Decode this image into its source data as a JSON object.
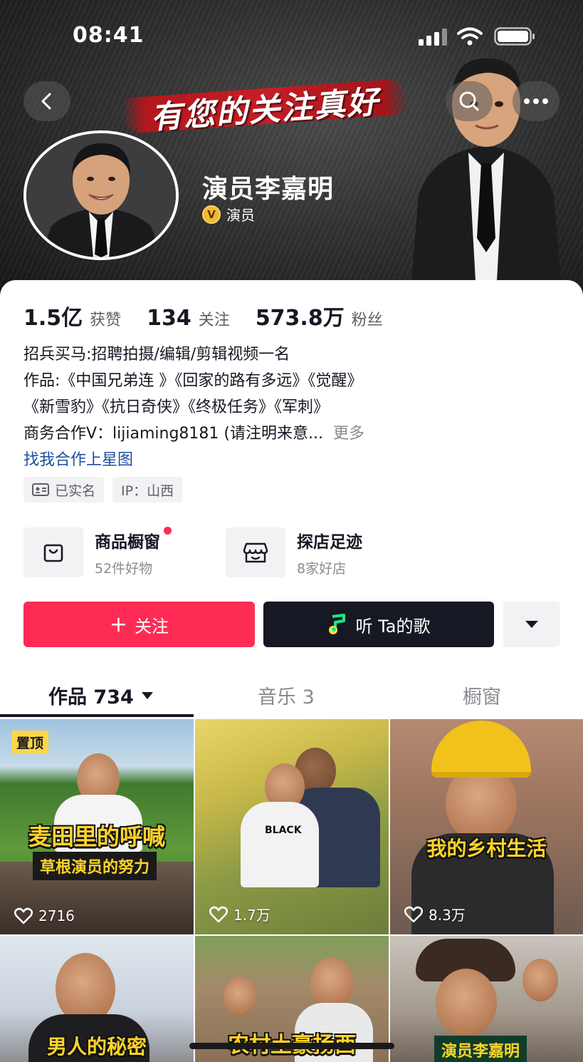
{
  "status_bar": {
    "time": "08:41"
  },
  "header": {
    "banner_text": "有您的关注真好",
    "username": "演员李嘉明",
    "verified_label": "演员",
    "verified_badge": "V"
  },
  "stats": [
    {
      "value": "1.5亿",
      "label": "获赞"
    },
    {
      "value": "134",
      "label": "关注"
    },
    {
      "value": "573.8万",
      "label": "粉丝"
    }
  ],
  "bio": {
    "lines": [
      "招兵买马:招聘拍摄/编辑/剪辑视频一名",
      "作品:《中国兄弟连 》《回家的路有多远》《觉醒》",
      "《新雪豹》《抗日奇侠》《终极任务》《军刺》",
      "商务合作V：lijiaming8181 (请注明来意..."
    ],
    "more": "更多",
    "link": "找我合作上星图"
  },
  "tags": [
    {
      "icon": "id-card-icon",
      "label": "已实名"
    },
    {
      "label": "IP：山西"
    }
  ],
  "shop": [
    {
      "icon": "shopping-bag-icon",
      "title": "商品橱窗",
      "subtitle": "52件好物"
    },
    {
      "icon": "store-icon",
      "title": "探店足迹",
      "subtitle": "8家好店"
    }
  ],
  "buttons": {
    "follow": "关注",
    "follow_icon": "+",
    "music": "听 Ta的歌"
  },
  "tabs": [
    {
      "label": "作品 734"
    },
    {
      "label": "音乐 3"
    },
    {
      "label": "橱窗"
    }
  ],
  "videos": [
    {
      "pinned": "置顶",
      "caption": "麦田里的呼喊",
      "caption2": "草根演员的努力",
      "likes": "2716"
    },
    {
      "caption": "",
      "likes": "1.7万",
      "shirt_text": "BLACK"
    },
    {
      "caption": "我的乡村生活",
      "likes": "8.3万"
    },
    {
      "caption": "男人的秘密",
      "likes": ""
    },
    {
      "caption": "农村土豪扬西",
      "likes": ""
    },
    {
      "caption": "演员李嘉明",
      "likes": ""
    }
  ],
  "colors": {
    "follow_red": "#fe2c55",
    "dark_button": "#161823",
    "link_blue": "#1c4f9c",
    "pin_yellow": "#fbd64a",
    "caption_yellow": "#ffd428"
  }
}
